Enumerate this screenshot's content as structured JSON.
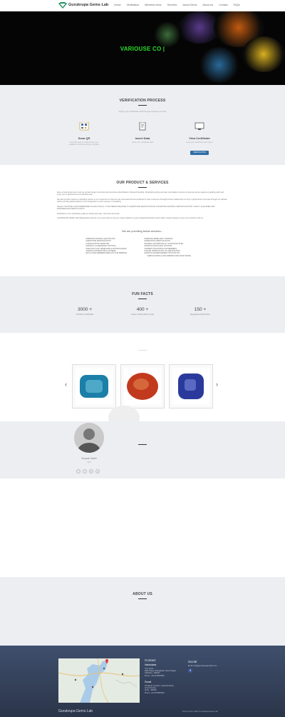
{
  "nav": {
    "brand": "Gurukrupa Gems Lab",
    "menu": [
      "Home",
      "Verification",
      "Members Area",
      "Services",
      "About Gems",
      "About Us",
      "Contact",
      "FAQs"
    ]
  },
  "hero": {
    "title": "VARIOUSE CO |"
  },
  "verification": {
    "title": "VERIFICATION PROCESS",
    "subtitle": "Verify your certificate with the given below process",
    "steps": [
      {
        "title": "Scan QR",
        "desc1": "Scan QR code to redirect from your",
        "desc2": "available certificate and gem website"
      },
      {
        "title": "Insert Data",
        "desc1": "Insert your Certificate data",
        "desc2": ""
      },
      {
        "title": "View Certificate",
        "desc1": "View your Certificate and verify it",
        "desc2": ""
      }
    ],
    "button": "VERIFICATION"
  },
  "products": {
    "title": "OUR PRODUCT & SERVICES",
    "paragraphs": [
      "Here at Gurukrupa Gems Lab we provide range of services like Gemstone Identification, Diamond Grading, Rudraksha testing and also consultation services to discuss various aspects regarding each and every one of gemstones at competitive rate.",
      "We also provide various co-branding options to our customers so that can get connected and remembered by their customers throughout their relationship not only in physical form but also through our website which provides global platform to be recognized in a 21st century of marketing.",
      "HIGHLY TRUSTED & RECOMMENDED PLACE FOR ALL YOUR NEEDS RELATED TO GEMSTONE IDENTIFICATION & DIAMOND GRADING CERTIFICATION BY HIGHLY QUALIFIED AND EXPERIENCED GEMOLOGISTS.",
      "Verification of our certificates made so simple and easy. Just scan and verify.",
      "GURUKRUPA GEMS LAB distinguishes itself as a one stop shop for all your needs related to a gemmological laboratory which offers unique features to give your business with us."
    ],
    "providing": "We are providing below services...",
    "services_left": [
      "DIAMOND GRADING (QUOTE-IOP)",
      "GEMSTONE IDENTIFICATION",
      "CONSULTATION SERVICES",
      "VARIOUS CO-BRANDING OPTIONS",
      "DISCOUNT FOR JEWELLERS & ASTROLOGERS",
      "VARIOUS PROMOTIONAL SCHEME",
      "EXCLUSIVE MEMBERS AREA ON OUR WEBSITE"
    ],
    "services_right": [
      "DIAMOND JEWELLERY GRADING",
      "RUDRAKSHA IDENTIFICATION",
      "DOUBLE LAB SERVICE AT YOUR DOOR STEP",
      "VARIOUS PACKAGING OPTIONS",
      "COMPETITIVE RATES FOR MEMBERS",
      "ONLINE VERIFICATION OF CERTIFICATES",
      "VARIOUS ADVERTISEMENT OPTIONS ON",
      "CERTIFICATES & OUR WEBSITE AND MUCH MORE..."
    ]
  },
  "facts": {
    "title": "FUN FACTS",
    "items": [
      {
        "number": "3000 +",
        "label": "Verified Certificate"
      },
      {
        "number": "400 +",
        "label": "Users visited last month"
      },
      {
        "number": "150 +",
        "label": "Registered Members"
      }
    ]
  },
  "gems": {
    "colors": [
      "#1b7fa8",
      "#c23a1e",
      "#2a3a9c"
    ]
  },
  "team": {
    "name": "Krupal Joshi",
    "role": "CEO",
    "socials": [
      "f",
      "t",
      "in",
      "g"
    ]
  },
  "about": {
    "title": "ABOUT US"
  },
  "footer": {
    "contact_title": "Contact",
    "city1": "Vadodara",
    "addr1": [
      "Your Gems",
      "Rahul Marg, Mangalwadi, Jhansi Nagar,",
      "Vadodara - 390001",
      "Phone: +91 9375991998"
    ],
    "city2": "Surat",
    "addr2": [
      "Vrindavan Complex, Varachha Road,",
      "Anand Society,",
      "Surat - 395006",
      "Phone: +91 9375991998"
    ],
    "social_title": "Social",
    "email": "Email: info@gurukrupagemslab.com",
    "brand": "Gurukrupa Gems Lab",
    "links": "Terms of Use  |  2021 © Gurukrupa Gems Lab"
  }
}
